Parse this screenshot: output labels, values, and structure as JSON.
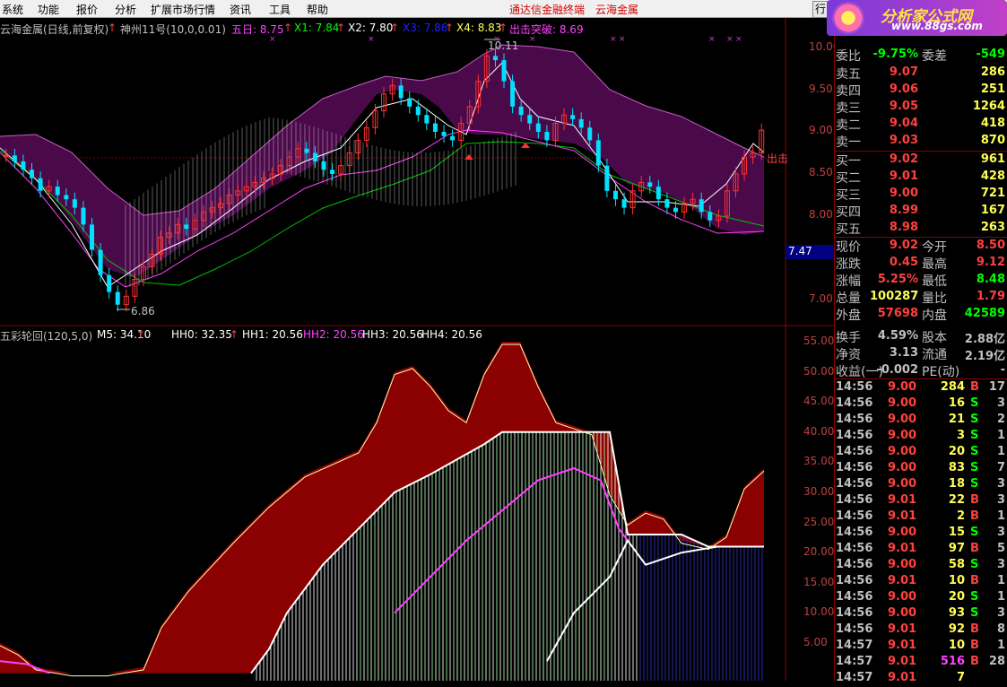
{
  "menu": {
    "items": [
      "系统",
      "功能",
      "报价",
      "分析",
      "扩展市场行情",
      "资讯",
      "工具",
      "帮助"
    ],
    "promo1": "通达信金融终端",
    "promo2": "云海金属",
    "right_btn": "行"
  },
  "logo": {
    "title": "分析家公式网",
    "url": "www.88gs.com"
  },
  "chart_header": {
    "stock": "云海金属(日线,前复权)",
    "indicator": "神州11号(10,0,0.01)",
    "five_day": "五日: 8.75",
    "x1": "X1: 7.84",
    "x2": "X2: 7.80",
    "x3": "X3: 7.86",
    "x4": "X4: 8.83",
    "breakout": "出击突破: 8.69",
    "label_out": "出击",
    "marker_high": "10.11",
    "marker_low": "6.86",
    "price_tag": "7.47"
  },
  "price_axis": [
    "10.00",
    "9.50",
    "9.00",
    "8.50",
    "8.00",
    "7.50",
    "7.00"
  ],
  "sub_header": {
    "name": "五彩轮回(120,5,0)",
    "m5": "M5: 34.10",
    "hh0": "HH0: 32.35",
    "hh1": "HH1: 20.56",
    "hh2": "HH2: 20.56",
    "hh3": "HH3: 20.56",
    "hh4": "HH4: 20.56"
  },
  "sub_axis": [
    "55.00",
    "50.00",
    "45.00",
    "40.00",
    "35.00",
    "30.00",
    "25.00",
    "20.00",
    "15.00",
    "10.00",
    "5.00"
  ],
  "quote": {
    "top_row": {
      "label": "委比",
      "value": "-9.75%",
      "label2": "委差",
      "value2": "-549"
    },
    "asks": [
      {
        "label": "卖五",
        "price": "9.07",
        "vol": "286"
      },
      {
        "label": "卖四",
        "price": "9.06",
        "vol": "251"
      },
      {
        "label": "卖三",
        "price": "9.05",
        "vol": "1264"
      },
      {
        "label": "卖二",
        "price": "9.04",
        "vol": "418"
      },
      {
        "label": "卖一",
        "price": "9.03",
        "vol": "870"
      }
    ],
    "bids": [
      {
        "label": "买一",
        "price": "9.02",
        "vol": "961"
      },
      {
        "label": "买二",
        "price": "9.01",
        "vol": "428"
      },
      {
        "label": "买三",
        "price": "9.00",
        "vol": "721"
      },
      {
        "label": "买四",
        "price": "8.99",
        "vol": "167"
      },
      {
        "label": "买五",
        "price": "8.98",
        "vol": "263"
      }
    ],
    "stats": [
      {
        "l1": "现价",
        "v1": "9.02",
        "c1": "#ff4040",
        "l2": "今开",
        "v2": "8.50",
        "c2": "#ff4040"
      },
      {
        "l1": "涨跌",
        "v1": "0.45",
        "c1": "#ff4040",
        "l2": "最高",
        "v2": "9.12",
        "c2": "#ff4040"
      },
      {
        "l1": "涨幅",
        "v1": "5.25%",
        "c1": "#ff4040",
        "l2": "最低",
        "v2": "8.48",
        "c2": "#00ff00"
      },
      {
        "l1": "总量",
        "v1": "100287",
        "c1": "#ffff54",
        "l2": "量比",
        "v2": "1.79",
        "c2": "#ff4040"
      },
      {
        "l1": "外盘",
        "v1": "57698",
        "c1": "#ff4040",
        "l2": "内盘",
        "v2": "42589",
        "c2": "#00ff00"
      },
      {
        "l1": "换手",
        "v1": "4.59%",
        "c1": "#c0c0c0",
        "l2": "股本",
        "v2": "2.88亿",
        "c2": "#c0c0c0"
      },
      {
        "l1": "净资",
        "v1": "3.13",
        "c1": "#c0c0c0",
        "l2": "流通",
        "v2": "2.19亿",
        "c2": "#c0c0c0"
      },
      {
        "l1": "收益(一)",
        "v1": "-0.002",
        "c1": "#c0c0c0",
        "l2": "PE(动)",
        "v2": "-",
        "c2": "#c0c0c0"
      }
    ],
    "ticks": [
      {
        "time": "14:56",
        "price": "9.00",
        "vol": "284",
        "bs": "B",
        "n": "17"
      },
      {
        "time": "14:56",
        "price": "9.00",
        "vol": "16",
        "bs": "S",
        "n": "3"
      },
      {
        "time": "14:56",
        "price": "9.00",
        "vol": "21",
        "bs": "S",
        "n": "2"
      },
      {
        "time": "14:56",
        "price": "9.00",
        "vol": "3",
        "bs": "S",
        "n": "1"
      },
      {
        "time": "14:56",
        "price": "9.00",
        "vol": "20",
        "bs": "S",
        "n": "1"
      },
      {
        "time": "14:56",
        "price": "9.00",
        "vol": "83",
        "bs": "S",
        "n": "7"
      },
      {
        "time": "14:56",
        "price": "9.00",
        "vol": "18",
        "bs": "S",
        "n": "3"
      },
      {
        "time": "14:56",
        "price": "9.01",
        "vol": "22",
        "bs": "B",
        "n": "3"
      },
      {
        "time": "14:56",
        "price": "9.01",
        "vol": "2",
        "bs": "B",
        "n": "1"
      },
      {
        "time": "14:56",
        "price": "9.00",
        "vol": "15",
        "bs": "S",
        "n": "3"
      },
      {
        "time": "14:56",
        "price": "9.01",
        "vol": "97",
        "bs": "B",
        "n": "5"
      },
      {
        "time": "14:56",
        "price": "9.00",
        "vol": "58",
        "bs": "S",
        "n": "3"
      },
      {
        "time": "14:56",
        "price": "9.01",
        "vol": "10",
        "bs": "B",
        "n": "1"
      },
      {
        "time": "14:56",
        "price": "9.00",
        "vol": "20",
        "bs": "S",
        "n": "1"
      },
      {
        "time": "14:56",
        "price": "9.00",
        "vol": "93",
        "bs": "S",
        "n": "3"
      },
      {
        "time": "14:56",
        "price": "9.01",
        "vol": "92",
        "bs": "B",
        "n": "8"
      },
      {
        "time": "14:57",
        "price": "9.01",
        "vol": "10",
        "bs": "B",
        "n": "1"
      },
      {
        "time": "14:57",
        "price": "9.01",
        "vol": "516",
        "bs": "B",
        "n": "28"
      },
      {
        "time": "14:57",
        "price": "9.01",
        "vol": "7",
        "bs": "",
        "n": ""
      }
    ]
  }
}
